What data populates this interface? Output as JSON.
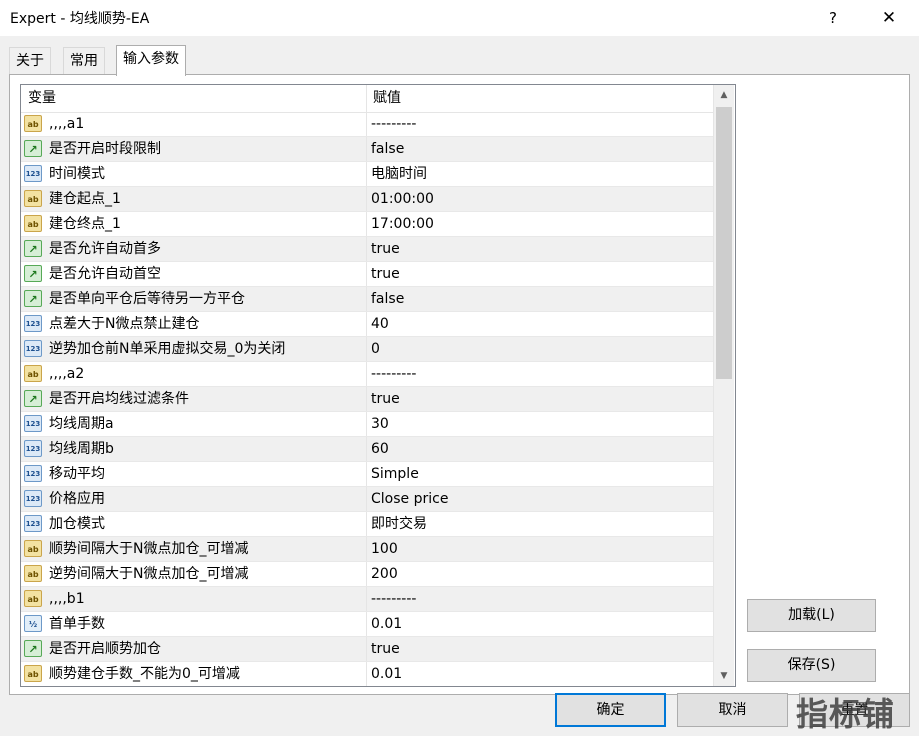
{
  "window": {
    "title": "Expert - 均线顺势-EA",
    "help_glyph": "?",
    "close_glyph": "✕"
  },
  "tabs": [
    {
      "label": "关于"
    },
    {
      "label": "常用"
    },
    {
      "label": "输入参数",
      "active": true
    }
  ],
  "grid": {
    "columns": {
      "variable": "变量",
      "value": "赋值"
    },
    "rows": [
      {
        "icon": "ab",
        "name": ",,,,a1",
        "value": "---------"
      },
      {
        "icon": "bool",
        "name": "是否开启时段限制",
        "value": "false"
      },
      {
        "icon": "int",
        "name": "时间模式",
        "value": "电脑时间"
      },
      {
        "icon": "ab",
        "name": "建仓起点_1",
        "value": "01:00:00"
      },
      {
        "icon": "ab",
        "name": "建仓终点_1",
        "value": "17:00:00"
      },
      {
        "icon": "bool",
        "name": "是否允许自动首多",
        "value": "true"
      },
      {
        "icon": "bool",
        "name": "是否允许自动首空",
        "value": "true"
      },
      {
        "icon": "bool",
        "name": "是否单向平仓后等待另一方平仓",
        "value": "false"
      },
      {
        "icon": "int",
        "name": "点差大于N微点禁止建仓",
        "value": "40"
      },
      {
        "icon": "int",
        "name": "逆势加仓前N单采用虚拟交易_0为关闭",
        "value": "0"
      },
      {
        "icon": "ab",
        "name": ",,,,a2",
        "value": "---------"
      },
      {
        "icon": "bool",
        "name": "是否开启均线过滤条件",
        "value": "true"
      },
      {
        "icon": "int",
        "name": "均线周期a",
        "value": "30"
      },
      {
        "icon": "int",
        "name": "均线周期b",
        "value": "60"
      },
      {
        "icon": "int",
        "name": "移动平均",
        "value": "Simple"
      },
      {
        "icon": "int",
        "name": "价格应用",
        "value": "Close price"
      },
      {
        "icon": "int",
        "name": "加仓模式",
        "value": "即时交易"
      },
      {
        "icon": "ab",
        "name": "顺势间隔大于N微点加仓_可增减",
        "value": "100"
      },
      {
        "icon": "ab",
        "name": "逆势间隔大于N微点加仓_可增减",
        "value": "200"
      },
      {
        "icon": "ab",
        "name": ",,,,b1",
        "value": "---------"
      },
      {
        "icon": "dbl",
        "name": "首单手数",
        "value": "0.01"
      },
      {
        "icon": "bool",
        "name": "是否开启顺势加仓",
        "value": "true"
      },
      {
        "icon": "ab",
        "name": "顺势建仓手数_不能为0_可增减",
        "value": "0.01"
      }
    ]
  },
  "icon_glyphs": {
    "ab": "ab",
    "bool": "↗",
    "int": "123",
    "dbl": "½"
  },
  "scrollbar": {
    "up_glyph": "▲",
    "down_glyph": "▼"
  },
  "buttons": {
    "load": "加载(L)",
    "save": "保存(S)",
    "ok": "确定",
    "cancel": "取消",
    "reset": "重置"
  },
  "watermark": "指标铺"
}
